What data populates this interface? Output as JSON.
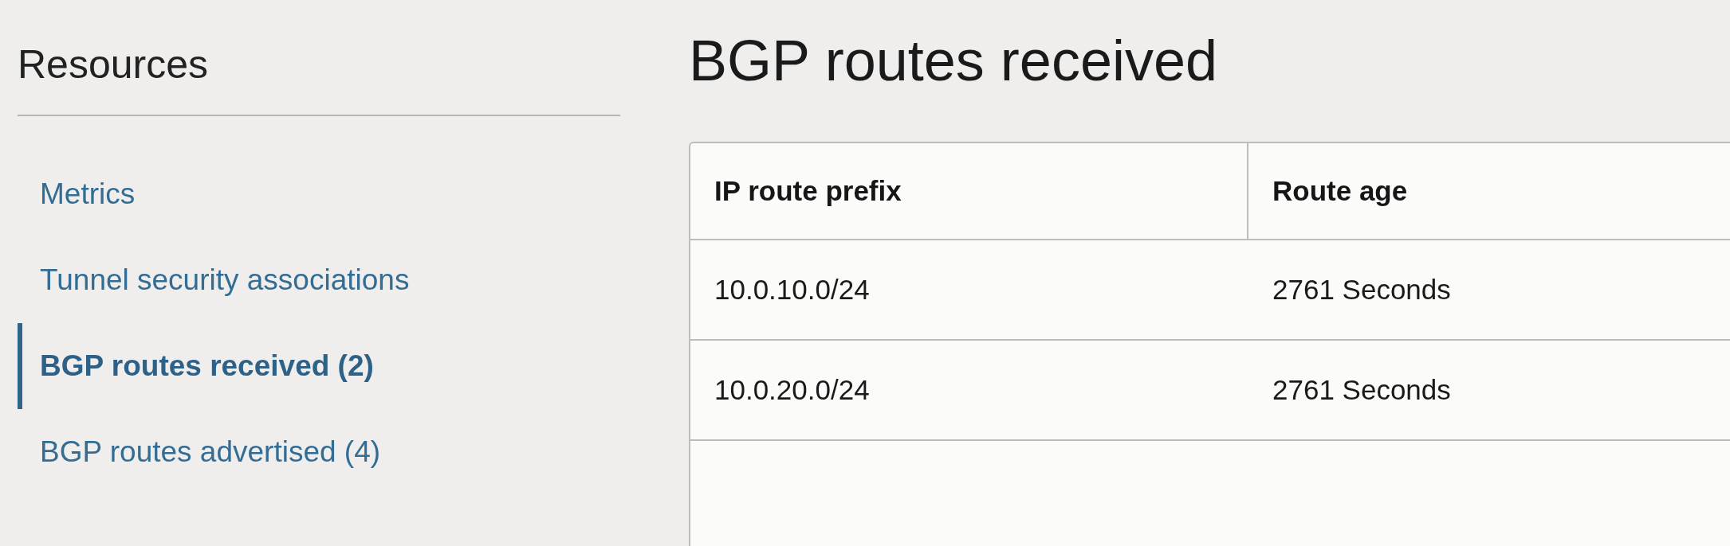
{
  "sidebar": {
    "title": "Resources",
    "items": [
      {
        "label": "Metrics",
        "selected": false
      },
      {
        "label": "Tunnel security associations",
        "selected": false
      },
      {
        "label": "BGP routes received (2)",
        "selected": true
      },
      {
        "label": "BGP routes advertised (4)",
        "selected": false
      }
    ]
  },
  "main": {
    "title": "BGP routes received",
    "table": {
      "columns": [
        "IP route prefix",
        "Route age"
      ],
      "rows": [
        [
          "10.0.10.0/24",
          "2761 Seconds"
        ],
        [
          "10.0.20.0/24",
          "2761 Seconds"
        ]
      ]
    }
  }
}
